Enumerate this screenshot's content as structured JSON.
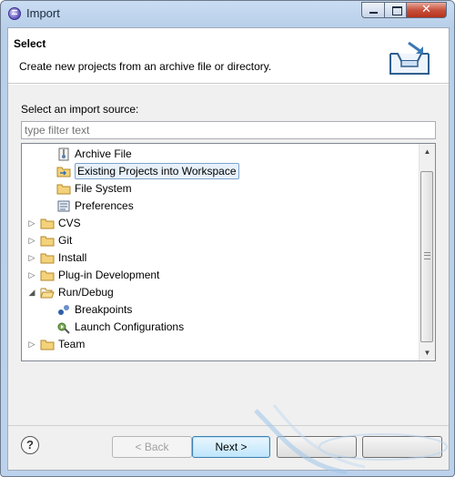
{
  "window": {
    "title": "Import"
  },
  "window_controls": {
    "minimize": "–",
    "maximize": "□",
    "close": "✕"
  },
  "header": {
    "title": "Select",
    "description": "Create new projects from an archive file or directory.",
    "icon": "import-wizard-icon"
  },
  "source": {
    "label": "Select an import source:",
    "filter_placeholder": "type filter text",
    "filter_value": ""
  },
  "tree": {
    "items": [
      {
        "label": "Archive File",
        "icon": "archive-file-icon",
        "depth": 1,
        "selected": false
      },
      {
        "label": "Existing Projects into Workspace",
        "icon": "existing-projects-icon",
        "depth": 1,
        "selected": true
      },
      {
        "label": "File System",
        "icon": "folder-icon",
        "depth": 1,
        "selected": false
      },
      {
        "label": "Preferences",
        "icon": "preferences-icon",
        "depth": 1,
        "selected": false
      },
      {
        "label": "CVS",
        "icon": "folder-icon",
        "depth": 0,
        "expanded": false
      },
      {
        "label": "Git",
        "icon": "folder-icon",
        "depth": 0,
        "expanded": false
      },
      {
        "label": "Install",
        "icon": "folder-icon",
        "depth": 0,
        "expanded": false
      },
      {
        "label": "Plug-in Development",
        "icon": "folder-icon",
        "depth": 0,
        "expanded": false
      },
      {
        "label": "Run/Debug",
        "icon": "folder-open-icon",
        "depth": 0,
        "expanded": true
      },
      {
        "label": "Breakpoints",
        "icon": "breakpoints-icon",
        "depth": 1,
        "selected": false
      },
      {
        "label": "Launch Configurations",
        "icon": "launch-configurations-icon",
        "depth": 1,
        "selected": false
      },
      {
        "label": "Team",
        "icon": "folder-icon",
        "depth": 0,
        "expanded": false
      }
    ]
  },
  "buttons": {
    "help": "?",
    "back": "< Back",
    "next": "Next >"
  },
  "colors": {
    "selection_border": "#7da2ce",
    "selection_fill": "#e8f1fb",
    "folder": "#e8c25a"
  }
}
